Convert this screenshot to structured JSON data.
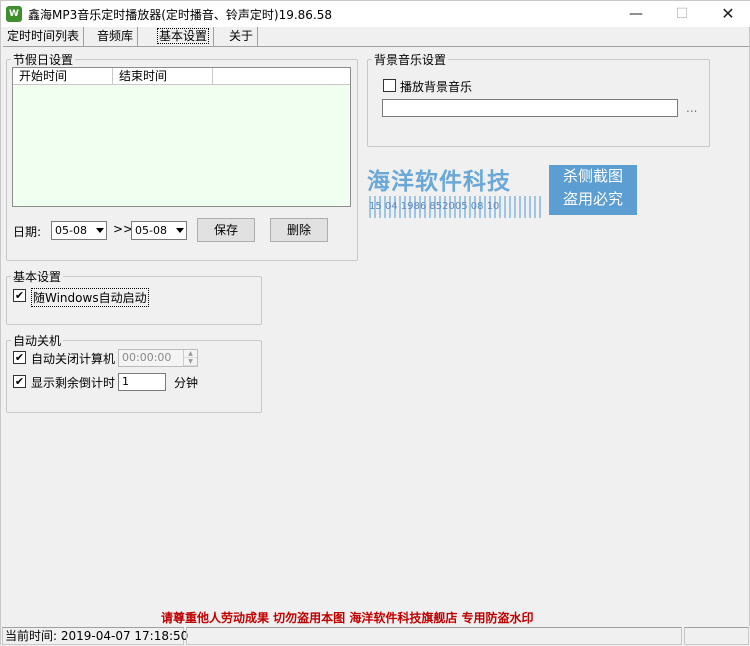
{
  "window": {
    "title": "鑫海MP3音乐定时播放器(定时播音、铃声定时)19.86.58",
    "icon_text": "W",
    "minimize": "—",
    "maximize": "☐",
    "close": "✕"
  },
  "tabs": [
    {
      "label": "定时时间列表"
    },
    {
      "label": "音频库"
    },
    {
      "label": "基本设置",
      "active": true
    },
    {
      "label": "关于"
    }
  ],
  "holiday": {
    "title": "节假日设置",
    "columns": [
      "开始时间",
      "结束时间"
    ],
    "date_label": "日期:",
    "start_date": "05-08",
    "separator": ">>",
    "end_date": "05-08",
    "save_label": "保存",
    "delete_label": "删除"
  },
  "bg_music": {
    "title": "背景音乐设置",
    "play_label": "播放背景音乐",
    "play_checked": false,
    "path_value": "",
    "browse_label": "..."
  },
  "basic": {
    "title": "基本设置",
    "autostart_label": "随Windows自动启动",
    "autostart_checked": true
  },
  "shutdown": {
    "title": "自动关机",
    "auto_shutdown_label": "自动关闭计算机",
    "auto_shutdown_checked": true,
    "time_value": "00:00:00",
    "countdown_label": "显示剩余倒计时",
    "countdown_checked": true,
    "countdown_value": "1",
    "minutes_label": "分钟"
  },
  "watermark": {
    "title": "海洋软件科技",
    "barcode_text": "15 04 1986 852005 08 10",
    "box_line1": "杀侧截图",
    "box_line2": "盗用必究"
  },
  "footer_warning": "请尊重他人劳动成果   切勿盗用本图   海洋软件科技旗舰店   专用防盗水印",
  "status": {
    "time_text": "当前时间:  2019-04-07 17:18:50"
  },
  "colors": {
    "listview_bg": "#f0fff0",
    "warning_text": "#c00000",
    "watermark_blue": "#5d9ed2"
  }
}
